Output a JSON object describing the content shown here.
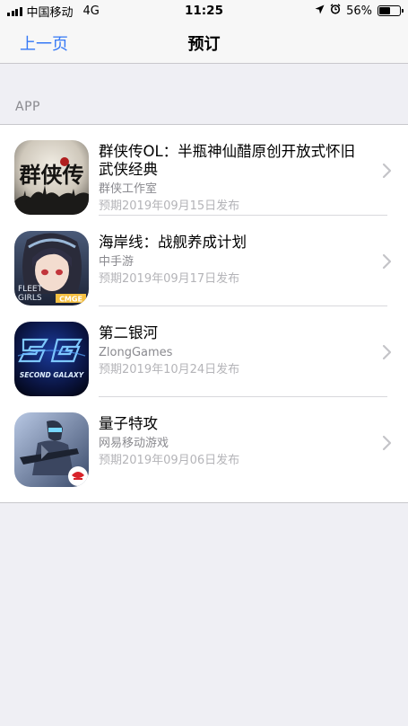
{
  "status_bar": {
    "carrier": "中国移动",
    "network": "4G",
    "time": "11:25",
    "battery": "56%",
    "battery_level": 0.56
  },
  "nav": {
    "back_label": "上一页",
    "title": "预订"
  },
  "section": {
    "header": "APP"
  },
  "apps": [
    {
      "name": "群侠传OL：半瓶神仙醋原创开放式怀旧武侠经典",
      "developer": "群侠工作室",
      "release": "预期2019年09月15日发布",
      "icon": "qunxiazhuan-app-icon",
      "icon_text": "群侠传"
    },
    {
      "name": "海岸线：战舰养成计划",
      "developer": "中手游",
      "release": "预期2019年09月17日发布",
      "icon": "fleet-girls-app-icon",
      "icon_text_1": "FLEET",
      "icon_text_2": "GIRLS",
      "icon_text_3": "CMGE"
    },
    {
      "name": "第二银河",
      "developer": "ZlongGames",
      "release": "预期2019年10月24日发布",
      "icon": "second-galaxy-app-icon",
      "icon_text": "SECOND GALAXY"
    },
    {
      "name": "量子特攻",
      "developer": "网易移动游戏",
      "release": "预期2019年09月06日发布",
      "icon": "quantum-strike-app-icon"
    }
  ],
  "colors": {
    "accent": "#3478f6",
    "background": "#efeff4",
    "secondary_text": "#8a8a8f",
    "tertiary_text": "#b4b4b8"
  }
}
